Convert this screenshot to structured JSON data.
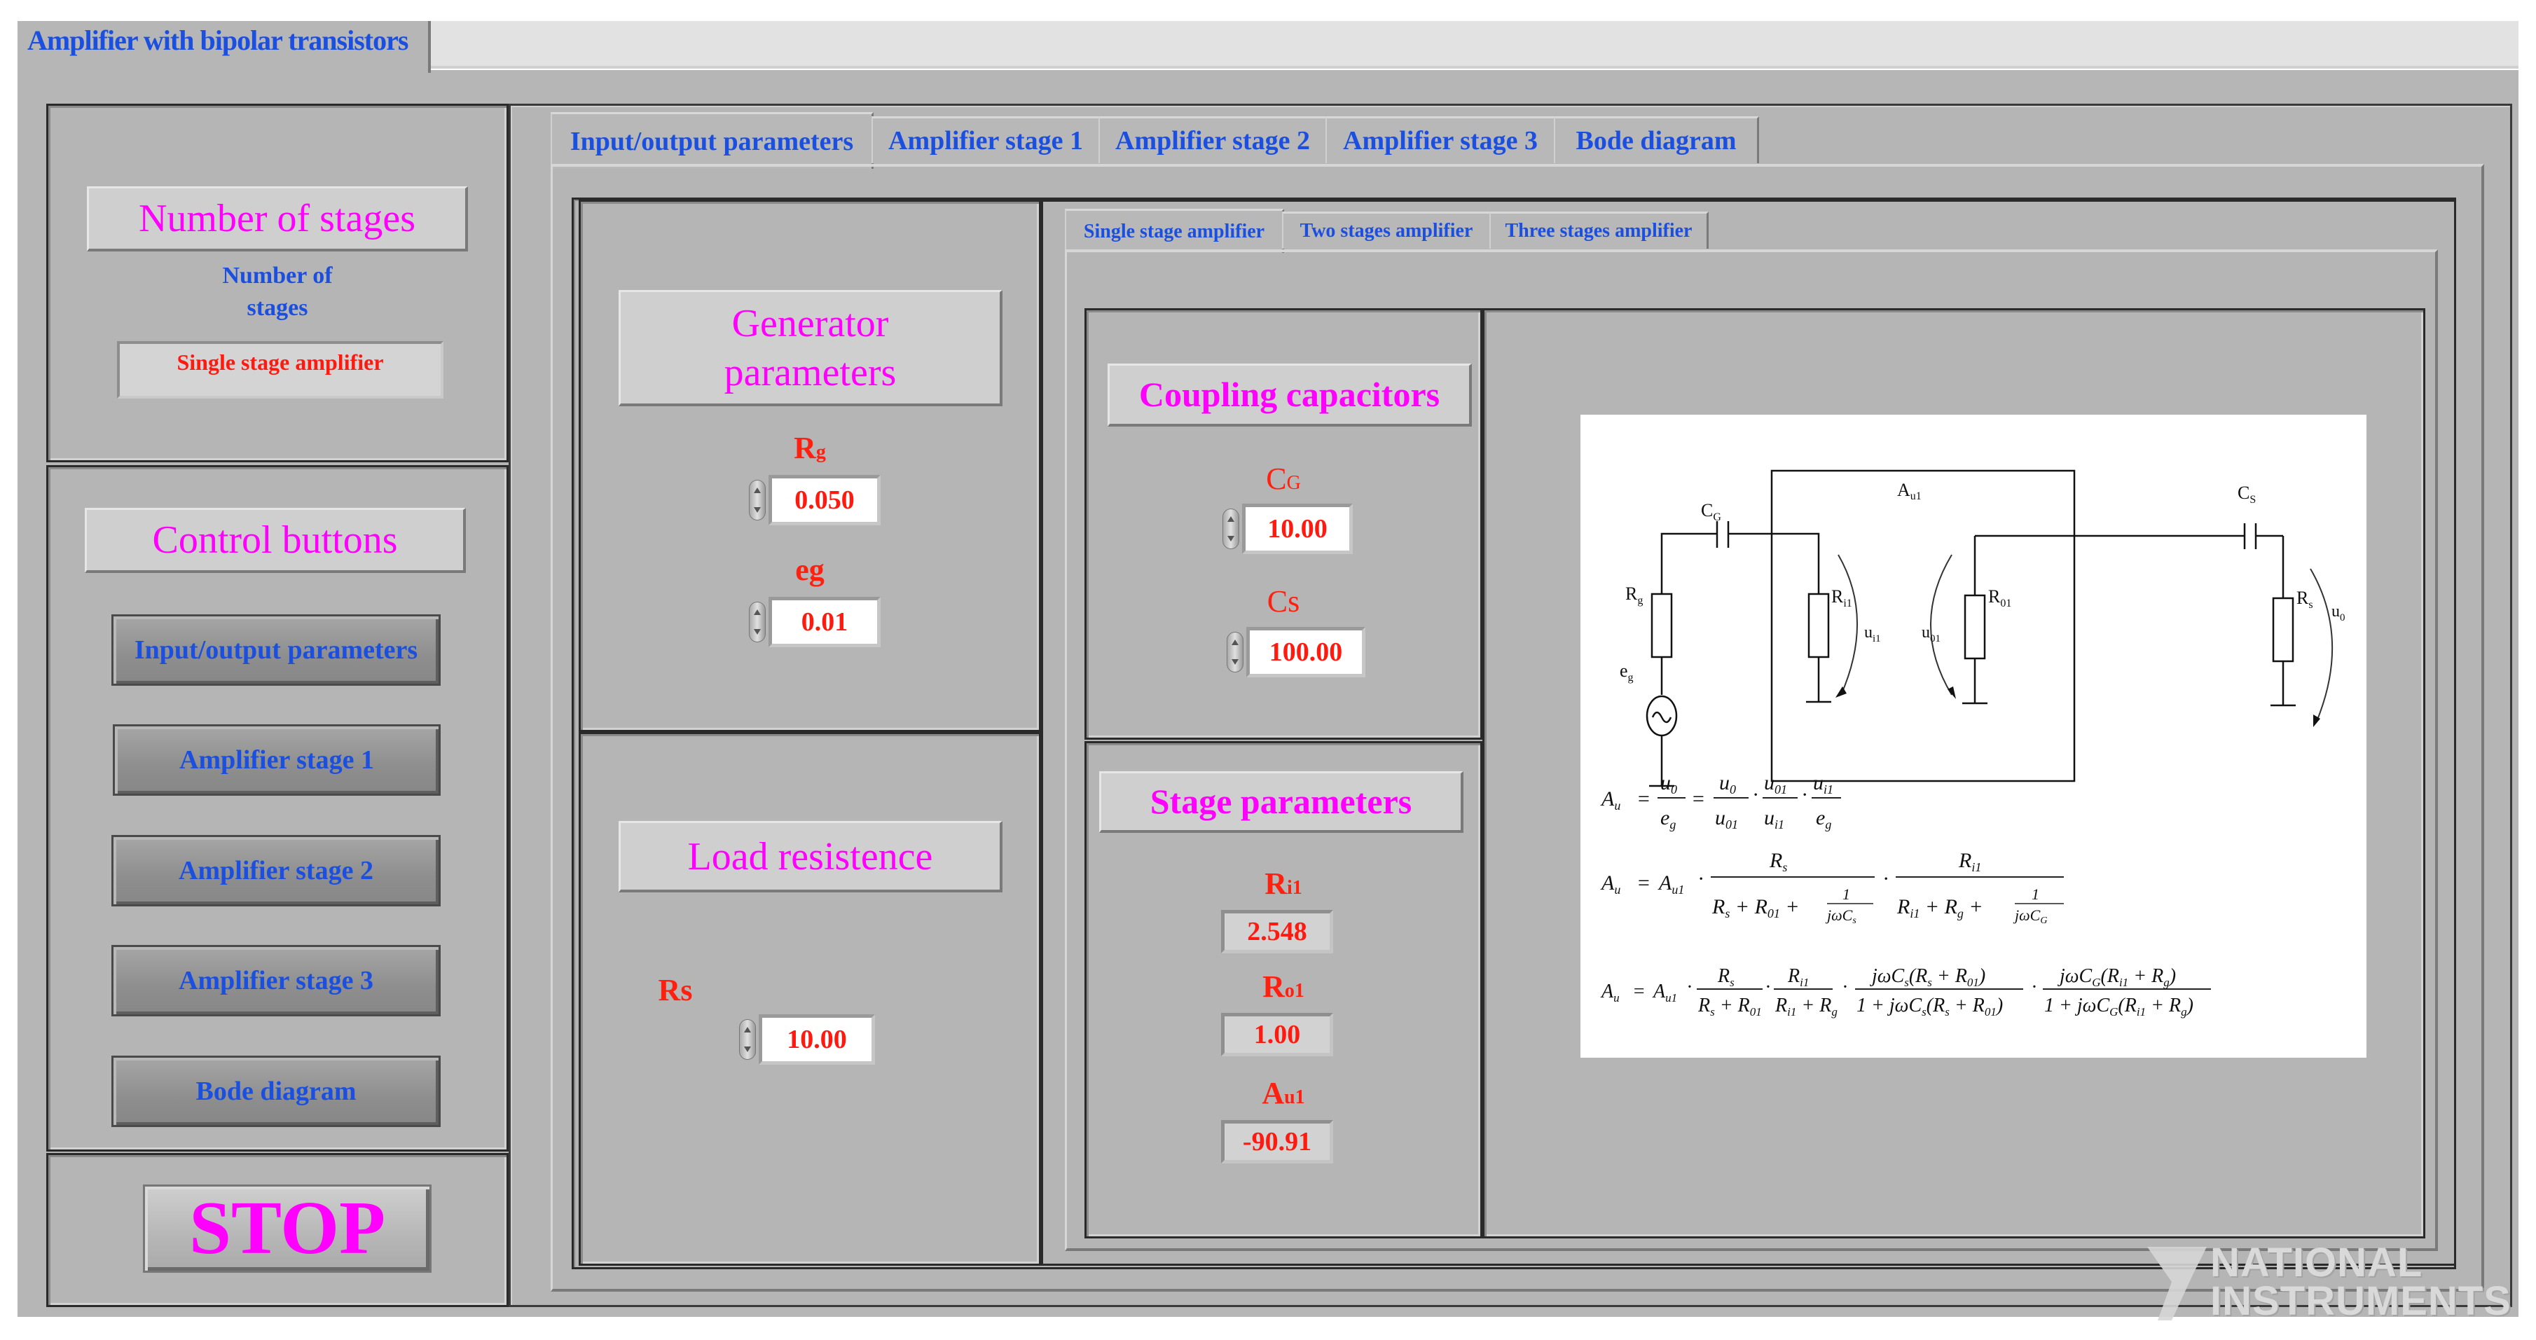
{
  "window": {
    "tab_title": "Amplifier with bipolar transistors"
  },
  "left_panel": {
    "stages_section": {
      "title": "Number of stages",
      "control_label_line1": "Number of",
      "control_label_line2": "stages",
      "selected_value": "Single stage amplifier"
    },
    "control_section": {
      "title": "Control buttons",
      "buttons": [
        {
          "label": "Input/output parameters"
        },
        {
          "label": "Amplifier stage 1"
        },
        {
          "label": "Amplifier stage 2"
        },
        {
          "label": "Amplifier stage 3"
        },
        {
          "label": "Bode diagram"
        }
      ]
    },
    "stop_label": "STOP"
  },
  "main_tabs": [
    {
      "label": "Input/output parameters",
      "active": true
    },
    {
      "label": "Amplifier stage 1",
      "active": false
    },
    {
      "label": "Amplifier stage 2",
      "active": false
    },
    {
      "label": "Amplifier stage 3",
      "active": false
    },
    {
      "label": "Bode diagram",
      "active": false
    }
  ],
  "generator": {
    "title_line1": "Generator",
    "title_line2": "parameters",
    "rg": {
      "label": "R",
      "sub": "g",
      "value": "0.050"
    },
    "eg": {
      "label": "eg",
      "value": "0.01"
    }
  },
  "load": {
    "title": "Load resistence",
    "rs": {
      "label": "Rs",
      "value": "10.00"
    }
  },
  "sub_tabs": [
    {
      "label": "Single stage amplifier",
      "active": true
    },
    {
      "label": "Two stages amplifier",
      "active": false
    },
    {
      "label": "Three stages amplifier",
      "active": false
    }
  ],
  "coupling": {
    "title": "Coupling capacitors",
    "cg": {
      "label": "C",
      "sub": "G",
      "value": "10.00"
    },
    "cs": {
      "label": "Cs",
      "value": "100.00"
    }
  },
  "stage_params": {
    "title": "Stage parameters",
    "ri1": {
      "label": "R",
      "sub": "i1",
      "value": "2.548"
    },
    "ro1": {
      "label": "R",
      "sub": "o1",
      "value": "1.00"
    },
    "au1": {
      "label": "A",
      "sub": "u1",
      "value": "-90.91"
    }
  },
  "figure": {
    "circuit_labels": {
      "cg": "C",
      "cg_sub": "G",
      "cs": "C",
      "cs_sub": "S",
      "au1": "A",
      "au1_sub": "u1",
      "rg": "R",
      "rg_sub": "g",
      "eg": "e",
      "eg_sub": "g",
      "ri1": "R",
      "ri1_sub": "i1",
      "ui1": "u",
      "ui1_sub": "i1",
      "uo1": "u",
      "uo1_sub": "01",
      "ro1": "R",
      "ro1_sub": "01",
      "rs": "R",
      "rs_sub": "s",
      "uo": "u",
      "uo_sub": "0"
    },
    "formulas": [
      "Au = u0/eg = (u0/u01)·(u01/ui1)·(ui1/eg)",
      "Au = Au1 · Rs/(Rs + R01 + 1/(jωCs)) · Ri1/(Ri1 + Rg + 1/(jωCG))",
      "Au = Au1 · Rs/(Rs + R01) · Ri1/(Ri1 + Rg) · jωCs(Rs + R01)/(1 + jωCs(Rs + R01)) · jωCG(Ri1 + Rg)/(1 + jωCG(Ri1 + Rg))"
    ]
  },
  "watermark": {
    "line1": "NATIONAL",
    "line2": "INSTRUMENTS"
  },
  "colors": {
    "title_magenta": "#ff00ff",
    "label_blue": "#1a4fe0",
    "value_red": "#ff1a10",
    "panel_gray": "#b6b6b6"
  }
}
